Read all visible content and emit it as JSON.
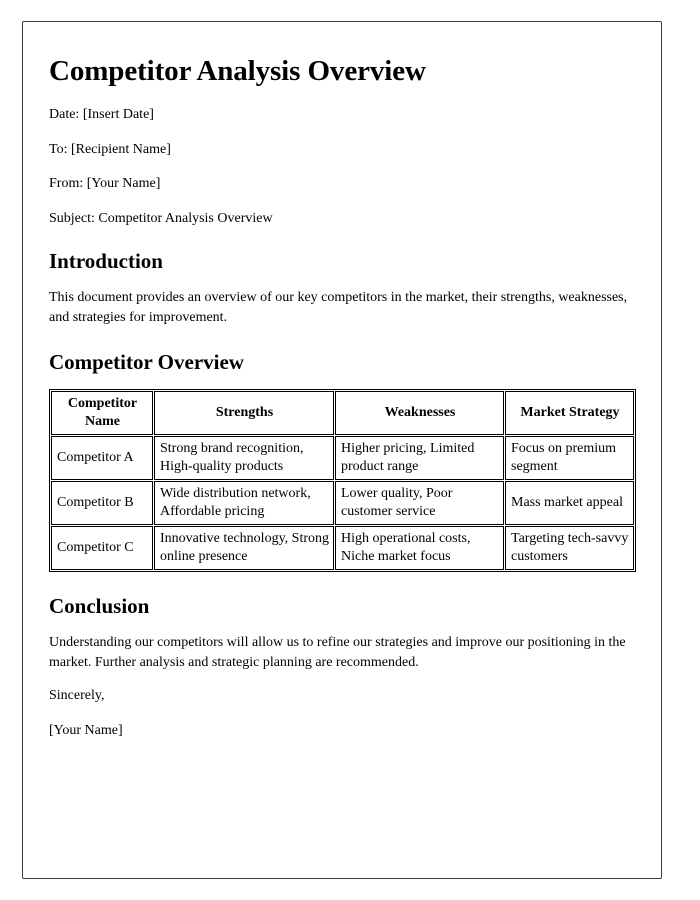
{
  "document": {
    "title": "Competitor Analysis Overview",
    "meta": [
      "Date: [Insert Date]",
      "To: [Recipient Name]",
      "From: [Your Name]",
      "Subject: Competitor Analysis Overview"
    ],
    "introduction": {
      "heading": "Introduction",
      "paragraph": "This document provides an overview of our key competitors in the market, their strengths, weaknesses, and strategies for improvement."
    },
    "competitor_overview": {
      "heading": "Competitor Overview",
      "table": {
        "columns": [
          "Competitor Name",
          "Strengths",
          "Weaknesses",
          "Market Strategy"
        ],
        "rows": [
          {
            "name": "Competitor A",
            "strengths": "Strong brand recognition, High-quality products",
            "weaknesses": "Higher pricing, Limited product range",
            "market_strategy": "Focus on premium segment"
          },
          {
            "name": "Competitor B",
            "strengths": "Wide distribution network, Affordable pricing",
            "weaknesses": "Lower quality, Poor customer service",
            "market_strategy": "Mass market appeal"
          },
          {
            "name": "Competitor C",
            "strengths": "Innovative technology, Strong online presence",
            "weaknesses": "High operational costs, Niche market focus",
            "market_strategy": "Targeting tech-savvy customers"
          }
        ]
      }
    },
    "conclusion": {
      "heading": "Conclusion",
      "paragraph": "Understanding our competitors will allow us to refine our strategies and improve our positioning in the market. Further analysis and strategic planning are recommended.",
      "closing": "Sincerely,",
      "signature": "[Your Name]"
    }
  },
  "colors": {
    "page_border": "#3a3a3a",
    "text": "#000000",
    "table_border": "#000000",
    "background": "#ffffff"
  }
}
